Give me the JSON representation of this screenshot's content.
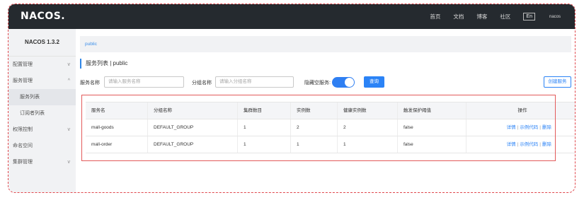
{
  "header": {
    "logo": "NACOS.",
    "nav": [
      "首页",
      "文档",
      "博客",
      "社区"
    ],
    "lang": "En",
    "user": "nacos"
  },
  "sidebar": {
    "version": "NACOS 1.3.2",
    "items": [
      {
        "label": "配置管理",
        "chevron": "v"
      },
      {
        "label": "服务管理",
        "chevron": "^"
      },
      {
        "label": "服务列表",
        "chevron": ""
      },
      {
        "label": "订阅者列表",
        "chevron": ""
      },
      {
        "label": "权限控制",
        "chevron": "v"
      },
      {
        "label": "命名空间",
        "chevron": ""
      },
      {
        "label": "集群管理",
        "chevron": "v"
      }
    ]
  },
  "namespace": "public",
  "title": "服务列表 | public",
  "filters": {
    "service_name_label": "服务名称",
    "service_name_placeholder": "请输入服务名称",
    "group_name_label": "分组名称",
    "group_name_placeholder": "请输入分组名称",
    "hide_empty_label": "隐藏空服务:",
    "query_button": "查询",
    "create_button": "创建服务"
  },
  "table": {
    "headers": [
      "服务名",
      "分组名称",
      "集群数目",
      "实例数",
      "健康实例数",
      "触发保护阈值",
      "操作"
    ],
    "rows": [
      {
        "cells": [
          "mall-goods",
          "DEFAULT_GROUP",
          "1",
          "2",
          "2",
          "false"
        ],
        "ops": [
          "详情",
          "示例代码",
          "删除"
        ]
      },
      {
        "cells": [
          "mall-order",
          "DEFAULT_GROUP",
          "1",
          "1",
          "1",
          "false"
        ],
        "ops": [
          "详情",
          "示例代码",
          "删除"
        ]
      }
    ]
  },
  "colors": {
    "accent": "#2b83f6",
    "topbar": "#252a2f",
    "highlight": "#e35a5a"
  }
}
